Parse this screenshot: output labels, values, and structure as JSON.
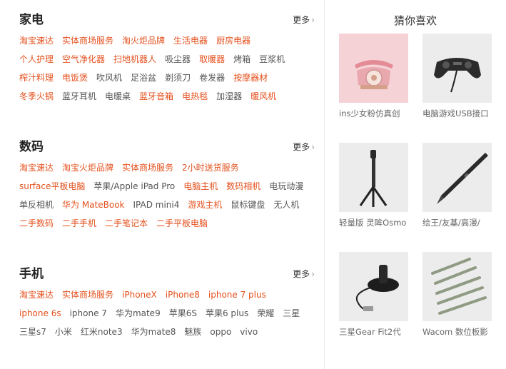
{
  "sections": [
    {
      "title": "家电",
      "more": "更多",
      "rows": [
        [
          {
            "t": "淘宝速达",
            "hot": true
          },
          {
            "t": "实体商场服务",
            "hot": true
          },
          {
            "t": "淘火炬品牌",
            "hot": true
          },
          {
            "t": "生活电器",
            "hot": true
          },
          {
            "t": "厨房电器",
            "hot": true
          }
        ],
        [
          {
            "t": "个人护理",
            "hot": true
          },
          {
            "t": "空气净化器",
            "hot": true
          },
          {
            "t": "扫地机器人",
            "hot": true
          },
          {
            "t": "吸尘器",
            "hot": false
          },
          {
            "t": "取暖器",
            "hot": true
          },
          {
            "t": "烤箱",
            "hot": false
          },
          {
            "t": "豆浆机",
            "hot": false
          }
        ],
        [
          {
            "t": "榨汁料理",
            "hot": true
          },
          {
            "t": "电饭煲",
            "hot": true
          },
          {
            "t": "吹风机",
            "hot": false
          },
          {
            "t": "足浴盆",
            "hot": false
          },
          {
            "t": "剃须刀",
            "hot": false
          },
          {
            "t": "卷发器",
            "hot": false
          },
          {
            "t": "按摩器材",
            "hot": true
          }
        ],
        [
          {
            "t": "冬季火锅",
            "hot": true
          },
          {
            "t": "蓝牙耳机",
            "hot": false
          },
          {
            "t": "电暖桌",
            "hot": false
          },
          {
            "t": "蓝牙音箱",
            "hot": true
          },
          {
            "t": "电热毯",
            "hot": true
          },
          {
            "t": "加湿器",
            "hot": false
          },
          {
            "t": "暖风机",
            "hot": true
          }
        ]
      ]
    },
    {
      "title": "数码",
      "more": "更多",
      "rows": [
        [
          {
            "t": "淘宝速达",
            "hot": true
          },
          {
            "t": "淘宝火炬品牌",
            "hot": true
          },
          {
            "t": "实体商场服务",
            "hot": true
          },
          {
            "t": "2小时送货服务",
            "hot": true
          }
        ],
        [
          {
            "t": "surface平板电脑",
            "hot": true
          },
          {
            "t": "苹果/Apple iPad Pro",
            "hot": false
          },
          {
            "t": "电脑主机",
            "hot": true
          },
          {
            "t": "数码相机",
            "hot": true
          },
          {
            "t": "电玩动漫",
            "hot": false
          }
        ],
        [
          {
            "t": "单反相机",
            "hot": false
          },
          {
            "t": "华为 MateBook",
            "hot": true
          },
          {
            "t": "IPAD mini4",
            "hot": false
          },
          {
            "t": "游戏主机",
            "hot": true
          },
          {
            "t": "鼠标键盘",
            "hot": false
          },
          {
            "t": "无人机",
            "hot": false
          }
        ],
        [
          {
            "t": "二手数码",
            "hot": true
          },
          {
            "t": "二手手机",
            "hot": true
          },
          {
            "t": "二手笔记本",
            "hot": true
          },
          {
            "t": "二手平板电脑",
            "hot": true
          }
        ]
      ]
    },
    {
      "title": "手机",
      "more": "更多",
      "rows": [
        [
          {
            "t": "淘宝速达",
            "hot": true
          },
          {
            "t": "实体商场服务",
            "hot": true
          },
          {
            "t": "iPhoneX",
            "hot": true
          },
          {
            "t": "iPhone8",
            "hot": true
          },
          {
            "t": "iphone 7 plus",
            "hot": true
          }
        ],
        [
          {
            "t": "iphone 6s",
            "hot": true
          },
          {
            "t": "iphone 7",
            "hot": false
          },
          {
            "t": "华为mate9",
            "hot": false
          },
          {
            "t": "苹果6S",
            "hot": false
          },
          {
            "t": "苹果6 plus",
            "hot": false
          },
          {
            "t": "荣耀",
            "hot": false
          },
          {
            "t": "三星",
            "hot": false
          }
        ],
        [
          {
            "t": "三星s7",
            "hot": false
          },
          {
            "t": "小米",
            "hot": false
          },
          {
            "t": "红米note3",
            "hot": false
          },
          {
            "t": "华为mate8",
            "hot": false
          },
          {
            "t": "魅族",
            "hot": false
          },
          {
            "t": "oppo",
            "hot": false
          },
          {
            "t": "vivo",
            "hot": false
          }
        ]
      ]
    }
  ],
  "guess": {
    "title": "猜你喜欢",
    "items": [
      {
        "caption": "ins少女粉仿真创",
        "image": "pink-rotary-phone"
      },
      {
        "caption": "电脑游戏USB接口",
        "image": "gamepad"
      },
      {
        "caption": "轻量版 灵眸Osmo",
        "image": "gimbal-tripod"
      },
      {
        "caption": "绘王/友基/高漫/",
        "image": "stylus-pen"
      },
      {
        "caption": "三星Gear Fit2代",
        "image": "charging-dock"
      },
      {
        "caption": "Wacom 数位板影",
        "image": "pen-nibs"
      }
    ]
  },
  "colors": {
    "hot": "#e4501d",
    "normal": "#555555",
    "divider": "#e9e9e9"
  }
}
